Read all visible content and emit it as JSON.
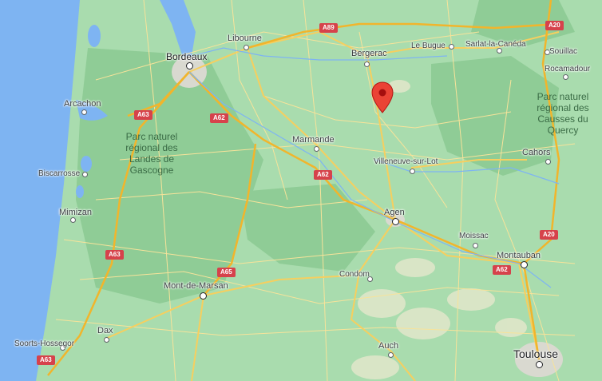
{
  "map": {
    "colors": {
      "land": "#a9dcae",
      "forest": "#8fcc96",
      "water": "#7eb4f2",
      "road": "#f7d36b",
      "highway": "#f1bd3a",
      "pin": "#ea4335"
    },
    "places": {
      "bordeaux": "Bordeaux",
      "libourne": "Libourne",
      "bergerac": "Bergerac",
      "le_bugue": "Le Bugue",
      "sarlat": "Sarlat-la-Canéda",
      "souillac": "Souillac",
      "rocamadour": "Rocamadour",
      "arcachon": "Arcachon",
      "biscarrosse": "Biscarrosse",
      "mimizan": "Mimizan",
      "marmande": "Marmande",
      "villeneuve": "Villeneuve-sur-Lot",
      "agen": "Agen",
      "moissac": "Moissac",
      "cahors": "Cahors",
      "montauban": "Montauban",
      "condom": "Condom",
      "mont_de_marsan": "Mont-de-Marsan",
      "dax": "Dax",
      "soorts": "Soorts-Hossegor",
      "auch": "Auch",
      "toulouse": "Toulouse"
    },
    "parks": {
      "landes": "Parc naturel régional des Landes de Gascogne",
      "quercy": "Parc naturel régional des Causses du Quercy"
    },
    "roads": {
      "a89": "A89",
      "a20_top": "A20",
      "a20_mid": "A20",
      "a63_arcachon": "A63",
      "a63_mimizan": "A63",
      "a63_bottom": "A63",
      "a62_bordeaux": "A62",
      "a62_marmande": "A62",
      "a62_montauban": "A62",
      "a65": "A65"
    },
    "marker": {
      "name": "location-pin"
    }
  }
}
